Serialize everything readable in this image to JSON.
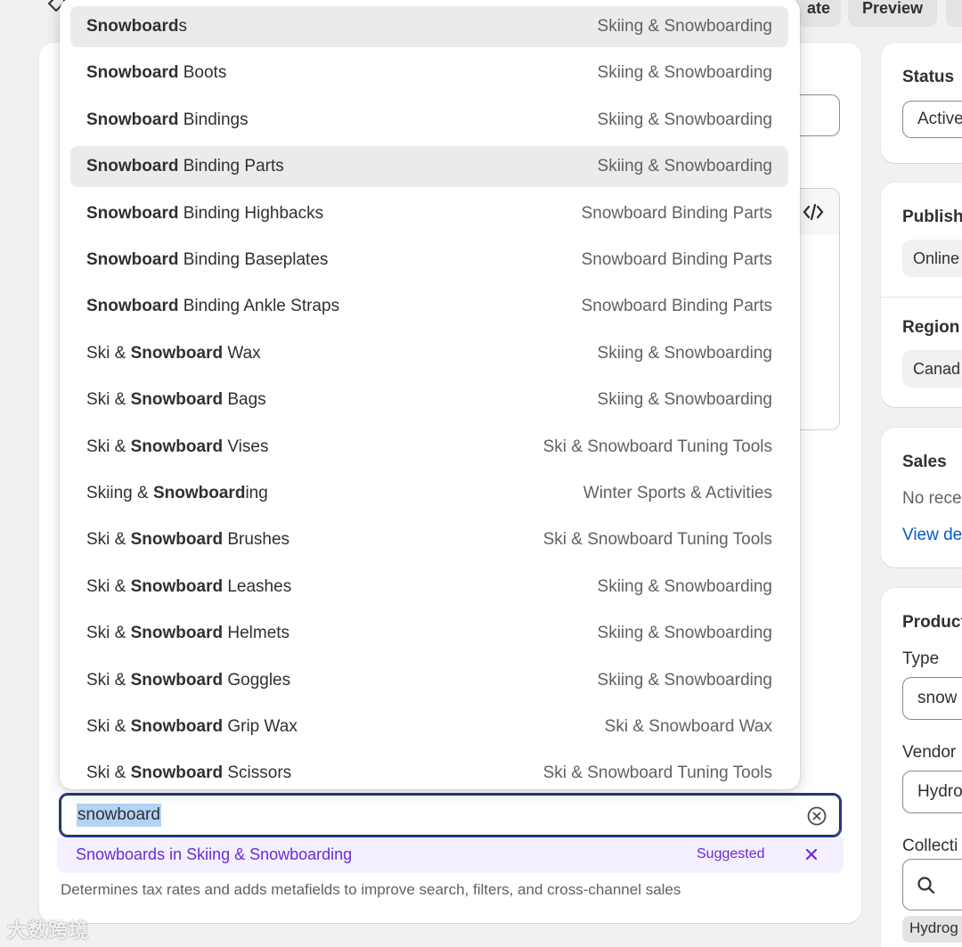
{
  "toolbar": {
    "duplicate_label": "ate",
    "preview_label": "Preview"
  },
  "status": {
    "title": "Status",
    "value": "Active"
  },
  "publishing": {
    "title": "Publish",
    "channel": "Online",
    "region_title": "Region",
    "region_value": "Canad"
  },
  "sales": {
    "title": "Sales",
    "text": "No rece",
    "link": "View de"
  },
  "organization": {
    "title": "Product",
    "type_label": "Type",
    "type_value": "snow",
    "vendor_label": "Vendor",
    "vendor_value": "Hydro",
    "collections_label": "Collecti",
    "collection_chip": "Hydrog"
  },
  "category": {
    "input_value": "snowboard",
    "suggestion": "Snowboards in Skiing & Snowboarding",
    "suggestion_badge": "Suggested",
    "helper": "Determines tax rates and adds metafields to improve search, filters, and cross-channel sales"
  },
  "dropdown": {
    "options": [
      {
        "pre": "",
        "bold": "Snowboard",
        "post": "s",
        "parent": "Skiing & Snowboarding",
        "highlighted": true
      },
      {
        "pre": "",
        "bold": "Snowboard",
        "post": " Boots",
        "parent": "Skiing & Snowboarding",
        "highlighted": false
      },
      {
        "pre": "",
        "bold": "Snowboard",
        "post": " Bindings",
        "parent": "Skiing & Snowboarding",
        "highlighted": false
      },
      {
        "pre": "",
        "bold": "Snowboard",
        "post": " Binding Parts",
        "parent": "Skiing & Snowboarding",
        "highlighted": true
      },
      {
        "pre": "",
        "bold": "Snowboard",
        "post": " Binding Highbacks",
        "parent": "Snowboard Binding Parts",
        "highlighted": false
      },
      {
        "pre": "",
        "bold": "Snowboard",
        "post": " Binding Baseplates",
        "parent": "Snowboard Binding Parts",
        "highlighted": false
      },
      {
        "pre": "",
        "bold": "Snowboard",
        "post": " Binding Ankle Straps",
        "parent": "Snowboard Binding Parts",
        "highlighted": false
      },
      {
        "pre": "Ski & ",
        "bold": "Snowboard",
        "post": " Wax",
        "parent": "Skiing & Snowboarding",
        "highlighted": false
      },
      {
        "pre": "Ski & ",
        "bold": "Snowboard",
        "post": " Bags",
        "parent": "Skiing & Snowboarding",
        "highlighted": false
      },
      {
        "pre": "Ski & ",
        "bold": "Snowboard",
        "post": " Vises",
        "parent": "Ski & Snowboard Tuning Tools",
        "highlighted": false
      },
      {
        "pre": "Skiing & ",
        "bold": "Snowboard",
        "post": "ing",
        "parent": "Winter Sports & Activities",
        "highlighted": false
      },
      {
        "pre": "Ski & ",
        "bold": "Snowboard",
        "post": " Brushes",
        "parent": "Ski & Snowboard Tuning Tools",
        "highlighted": false
      },
      {
        "pre": "Ski & ",
        "bold": "Snowboard",
        "post": " Leashes",
        "parent": "Skiing & Snowboarding",
        "highlighted": false
      },
      {
        "pre": "Ski & ",
        "bold": "Snowboard",
        "post": " Helmets",
        "parent": "Skiing & Snowboarding",
        "highlighted": false
      },
      {
        "pre": "Ski & ",
        "bold": "Snowboard",
        "post": " Goggles",
        "parent": "Skiing & Snowboarding",
        "highlighted": false
      },
      {
        "pre": "Ski & ",
        "bold": "Snowboard",
        "post": " Grip Wax",
        "parent": "Ski & Snowboard Wax",
        "highlighted": false
      },
      {
        "pre": "Ski & ",
        "bold": "Snowboard",
        "post": " Scissors",
        "parent": "Ski & Snowboard Tuning Tools",
        "highlighted": false
      }
    ]
  },
  "watermark": "大数跨境",
  "colors": {
    "accent_focus": "#1f3a8f",
    "suggest_purple": "#6b2bd9",
    "link_blue": "#005bd3",
    "highlight_row": "#ebebeb"
  }
}
